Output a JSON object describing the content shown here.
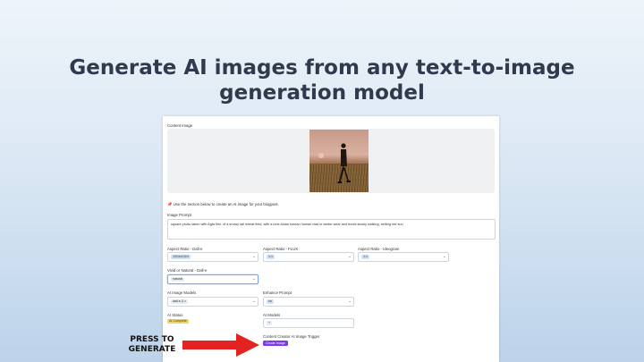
{
  "headline": {
    "line1": "Generate AI images from any text-to-image",
    "line2": "generation model"
  },
  "form": {
    "content_image_label": "Content Image",
    "notice": "Use the section below to create an AI image for your blogpost.",
    "notice_icon": "pin-icon",
    "image_prompt_label": "Image Prompt",
    "image_prompt_value": "square photo taken with Agfa film. of a snowy tall wheat field, with a lone Asian korean human clad in winter wear and boots slowly walking, setting red sun",
    "aspect_dalle_label": "Aspect Ratio - Dall-e",
    "aspect_dalle_value": "1024x1024",
    "aspect_flux_label": "Aspect Ratio - FLUX",
    "aspect_flux_value": "1:1",
    "aspect_ideogram_label": "Aspect Ratio - Ideogram",
    "aspect_ideogram_value": "1:1",
    "vivid_label": "Vivid or Natural - Dall-e",
    "vivid_value": "natural",
    "ai_models_label": "AI Image Models",
    "ai_models_value": "dall-e-3",
    "enhance_label": "Enhance Prompt",
    "enhance_value": "no",
    "ai_status_label": "AI Status",
    "ai_status_value": "AI Complete",
    "ai_models2_label": "AI Models",
    "ai_models2_value": "+",
    "trigger_label": "Content Creator AI Image Trigger",
    "create_button": "Create Image"
  },
  "annotation": {
    "line1": "PRESS TO",
    "line2": "GENERATE"
  },
  "colors": {
    "accent_button": "#7c3aed",
    "arrow": "#e32222",
    "status_badge": "#f3d46a"
  }
}
